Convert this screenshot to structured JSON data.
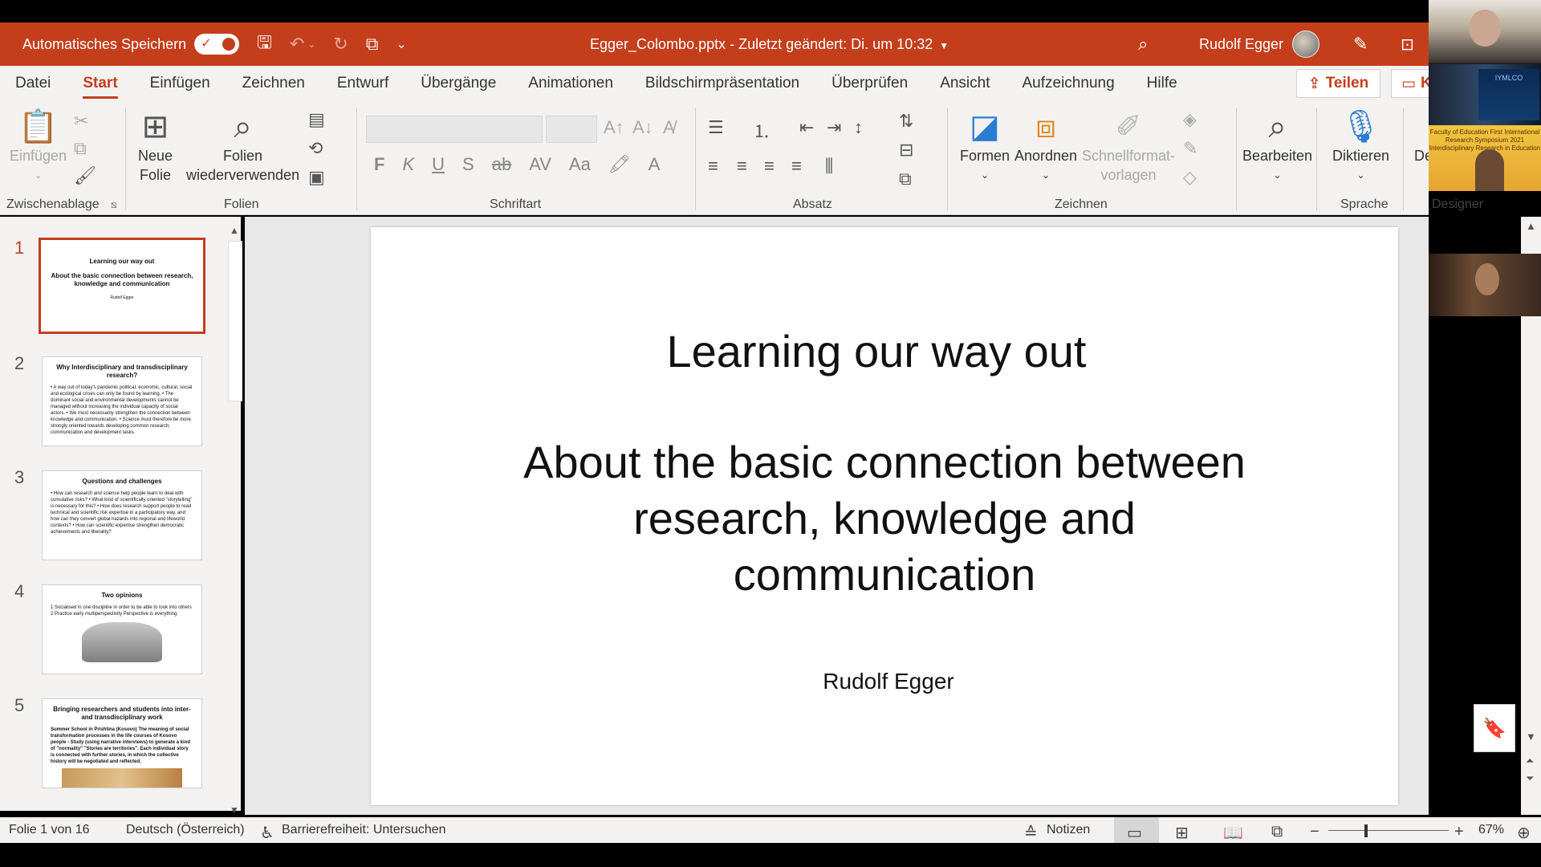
{
  "titlebar": {
    "autosave_label": "Automatisches Speichern",
    "document_title": "Egger_Colombo.pptx  -  Zuletzt geändert: Di. um 10:32",
    "user_name": "Rudolf Egger"
  },
  "menu": {
    "tabs": [
      "Datei",
      "Start",
      "Einfügen",
      "Zeichnen",
      "Entwurf",
      "Übergänge",
      "Animationen",
      "Bildschirmpräsentation",
      "Überprüfen",
      "Ansicht",
      "Aufzeichnung",
      "Hilfe"
    ],
    "active_tab": "Start",
    "share_label": "Teilen",
    "comment_label": "K"
  },
  "ribbon": {
    "groups": {
      "clipboard": "Zwischenablage",
      "slides": "Folien",
      "font": "Schriftart",
      "paragraph": "Absatz",
      "drawing": "Zeichnen",
      "voice": "Sprache",
      "designer": "Designer"
    },
    "buttons": {
      "paste": "Einfügen",
      "new_slide_1": "Neue",
      "new_slide_2": "Folie",
      "reuse_1": "Folien",
      "reuse_2": "wiederverwenden",
      "shapes": "Formen",
      "arrange": "Anordnen",
      "quickstyles_1": "Schnellformat-",
      "quickstyles_2": "vorlagen",
      "edit": "Bearbeiten",
      "dictate": "Diktieren",
      "designer_cut": "De"
    },
    "format_buttons": [
      "F",
      "K",
      "U",
      "S",
      "ab",
      "AV",
      "Aa"
    ]
  },
  "thumbnails": [
    {
      "num": "1",
      "title": "Learning our way out",
      "body": "About the basic connection between research, knowledge and communication",
      "footer": "Rudolf Egger"
    },
    {
      "num": "2",
      "title": "Why Interdisciplinary and transdisciplinary research?",
      "body": "• A way out of today's pandemic political, economic, cultural, social and ecological crises can only be found by learning. • The dominant social and environmental developments cannot be managed without increasing the individual capacity of social actors. • We must necessarily strengthen the connection between knowledge and communication. • Science must therefore be more strongly oriented towards developing common research, communication and development tasks."
    },
    {
      "num": "3",
      "title": "Questions and challenges",
      "body": "• How can research and science help people learn to deal with cumulative risks? • What kind of scientifically oriented \"storytelling\" is necessary for this? • How does research support people to read technical and scientific risk expertise in a participatory way, and how can they convert global hazards into regional and lifeworld contexts? • How can scientific expertise strengthen democratic achievements and liberality?"
    },
    {
      "num": "4",
      "title": "Two opinions",
      "body": "1 Socialised in one discipline in order to be able to look into others  2 Practice early multiperspectivity        Perspective is everything"
    },
    {
      "num": "5",
      "title": "Bringing researchers and students into inter- and transdisciplinary work",
      "body": "Summer School in Prishtina (Kosovo)  The meaning of social transformation processes in the life courses of Kosovo people - Study (using narrative interviews) to generate a kind of \"normality\" \"Stories are territories\". Each individual story is connected with further stories, in which the collective history will be negotiated and reflected."
    }
  ],
  "slide": {
    "title": "Learning our way out",
    "subtitle": "About the basic connection between research, knowledge and communication",
    "author": "Rudolf Egger"
  },
  "status": {
    "slide_info": "Folie 1 von 16",
    "language": "Deutsch (Österreich)",
    "accessibility": "Barrierefreiheit: Untersuchen",
    "notes": "Notizen",
    "zoom": "67%"
  },
  "video": {
    "poster_text": "IYMLCO",
    "banner_text": "Faculty of Education First International Research Symposium 2021 Interdisciplinary Research in Education"
  },
  "colors": {
    "accent": "#c43e1c",
    "ribbon_bg": "#f3f2f1"
  }
}
